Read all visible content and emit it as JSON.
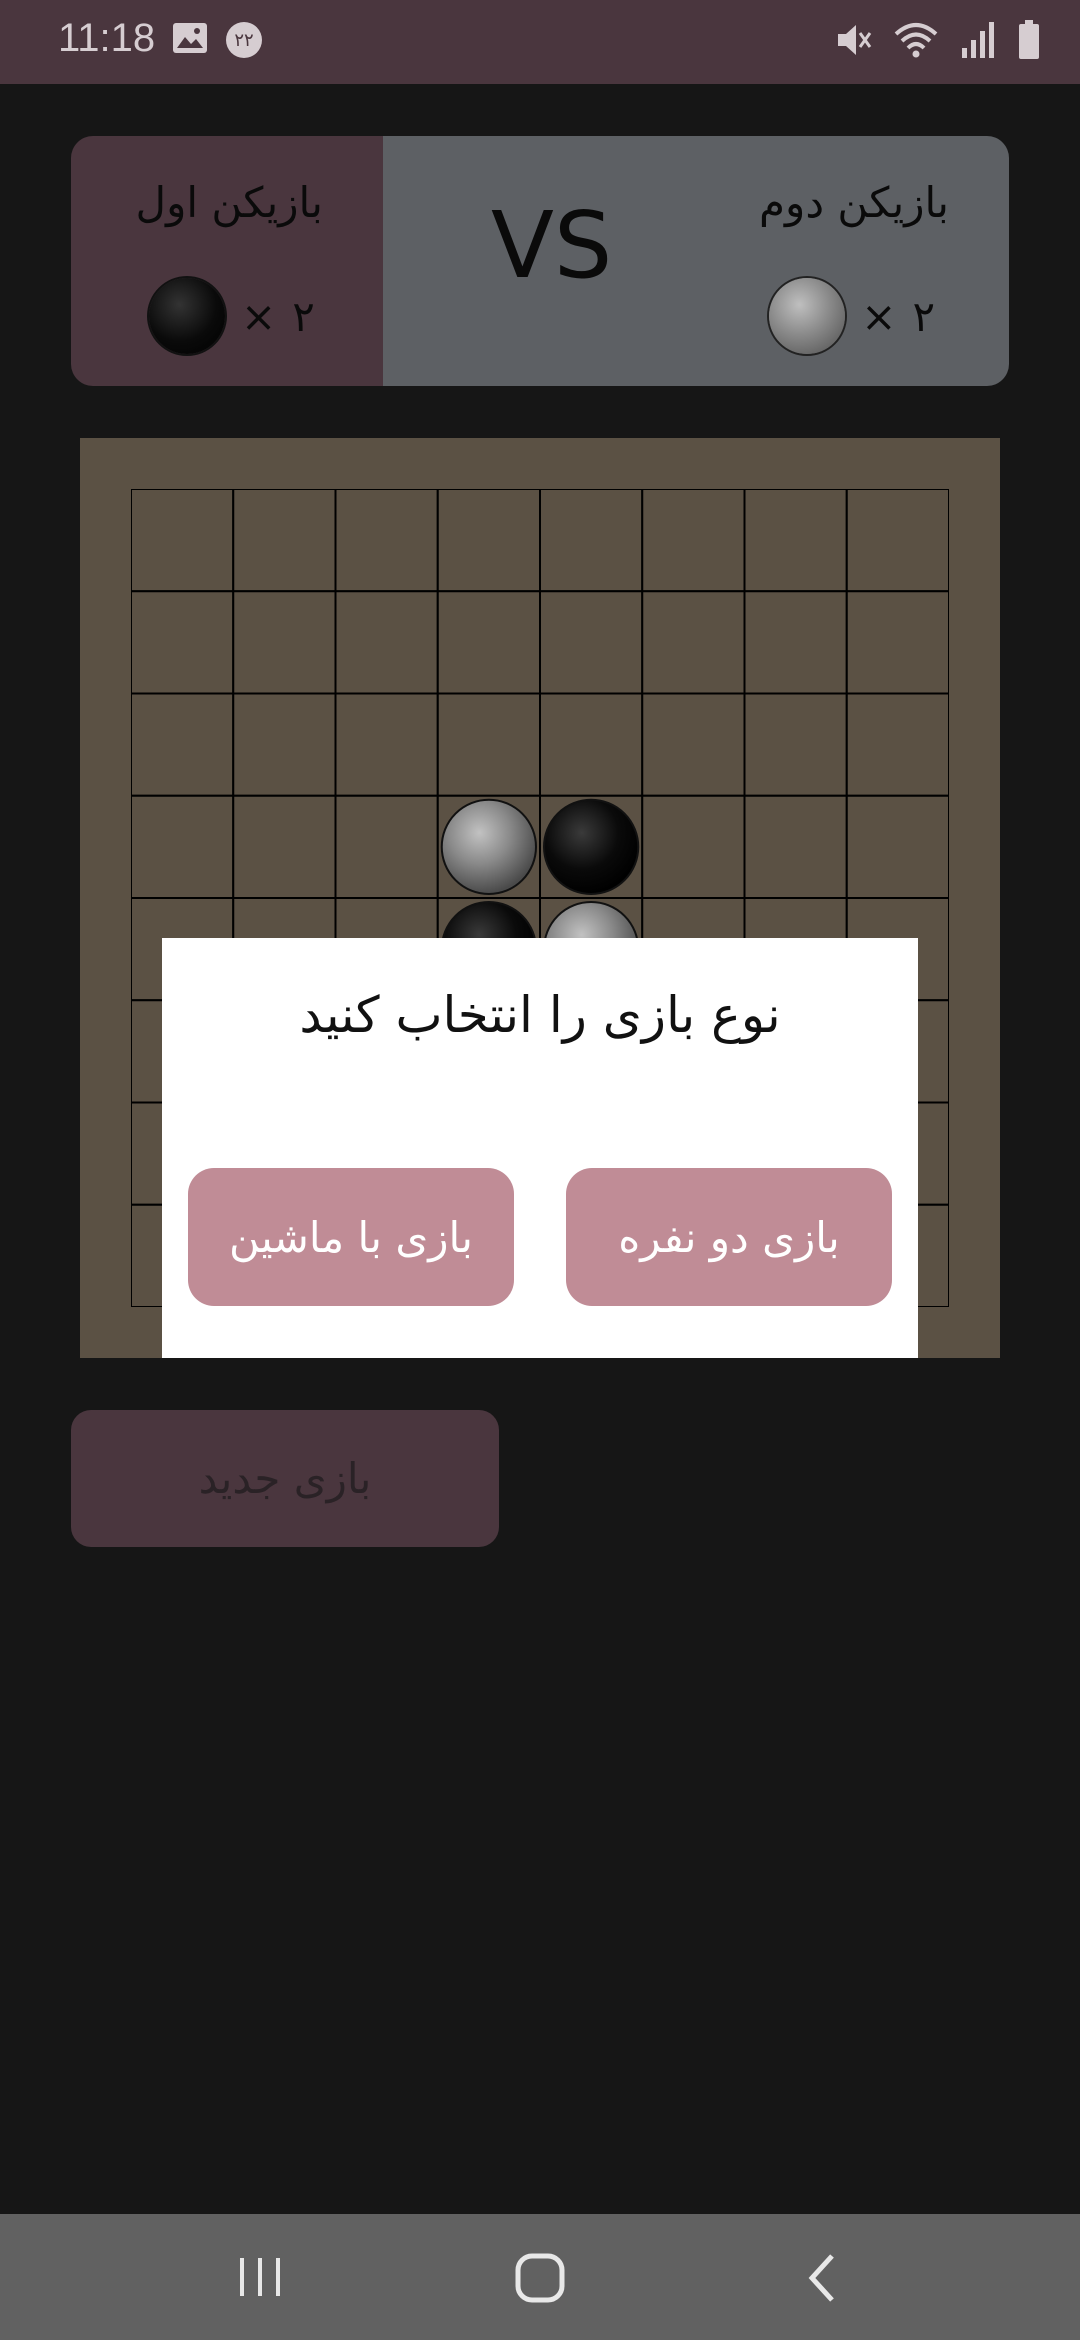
{
  "status_bar": {
    "time": "11:18",
    "left_icons": [
      "image-icon",
      "notification-count-badge"
    ],
    "badge_count": "۲۲",
    "right_icons": [
      "mute-icon",
      "wifi-icon",
      "signal-icon",
      "battery-icon"
    ]
  },
  "score": {
    "player1_label": "بازیکن اول",
    "player1_count": "۲",
    "player1_times": "×",
    "player2_label": "بازیکن دوم",
    "player2_count": "۲",
    "player2_times": "×",
    "vs": "VS"
  },
  "board": {
    "size": 8,
    "stones": [
      {
        "row": 3,
        "col": 3,
        "color": "gray"
      },
      {
        "row": 3,
        "col": 4,
        "color": "black"
      },
      {
        "row": 4,
        "col": 3,
        "color": "black"
      },
      {
        "row": 4,
        "col": 4,
        "color": "gray"
      }
    ]
  },
  "new_game_label": "بازی جدید",
  "dialog": {
    "title": "نوع بازی را انتخاب کنید",
    "machine_button": "بازی با ماشین",
    "two_player_button": "بازی دو نفره"
  },
  "nav": {
    "icons": [
      "recent-apps-icon",
      "home-icon",
      "back-icon"
    ]
  },
  "colors": {
    "accent": "#4a363e",
    "dialog_button": "#c08c96",
    "board": "#5b5144"
  }
}
